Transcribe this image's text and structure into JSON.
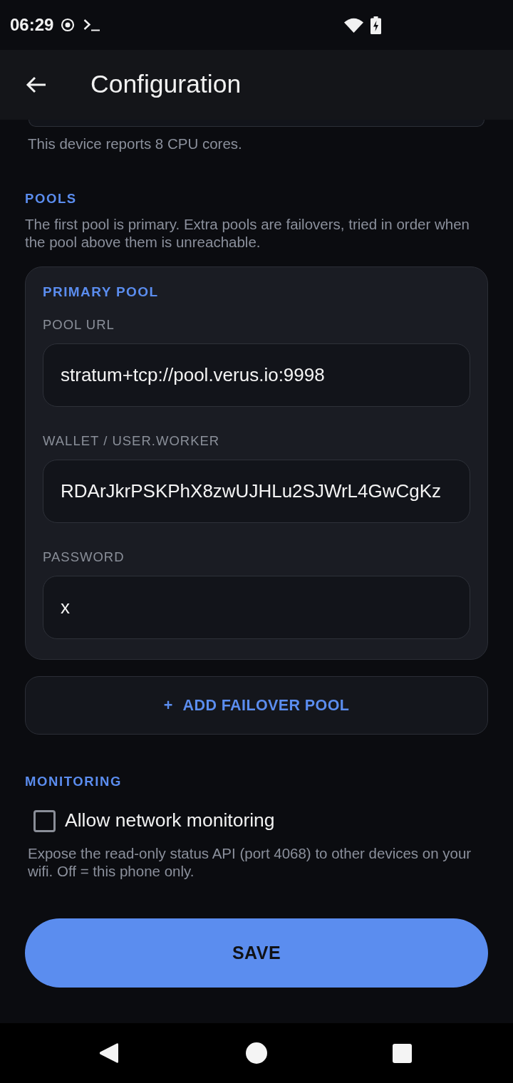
{
  "status_bar": {
    "time": "06:29"
  },
  "app_bar": {
    "title": "Configuration"
  },
  "cpu_note": "This device reports 8 CPU cores.",
  "pools": {
    "heading": "POOLS",
    "description": "The first pool is primary. Extra pools are failovers, tried in order when the pool above them is unreachable.",
    "primary_pool": {
      "title": "PRIMARY POOL",
      "fields": [
        {
          "label": "POOL URL",
          "value": "stratum+tcp://pool.verus.io:9998"
        },
        {
          "label": "WALLET / USER.WORKER",
          "value": "RDArJkrPSKPhX8zwUJHLu2SJWrL4GwCgKz"
        },
        {
          "label": "PASSWORD",
          "value": "x"
        }
      ]
    },
    "add_button": {
      "icon": "+",
      "label": "ADD FAILOVER POOL"
    }
  },
  "monitoring": {
    "heading": "MONITORING",
    "checkbox": {
      "label": "Allow network monitoring",
      "checked": false
    },
    "description": "Expose the read-only status API (port 4068) to other devices on your wifi. Off = this phone only."
  },
  "save_button": {
    "label": "SAVE"
  }
}
